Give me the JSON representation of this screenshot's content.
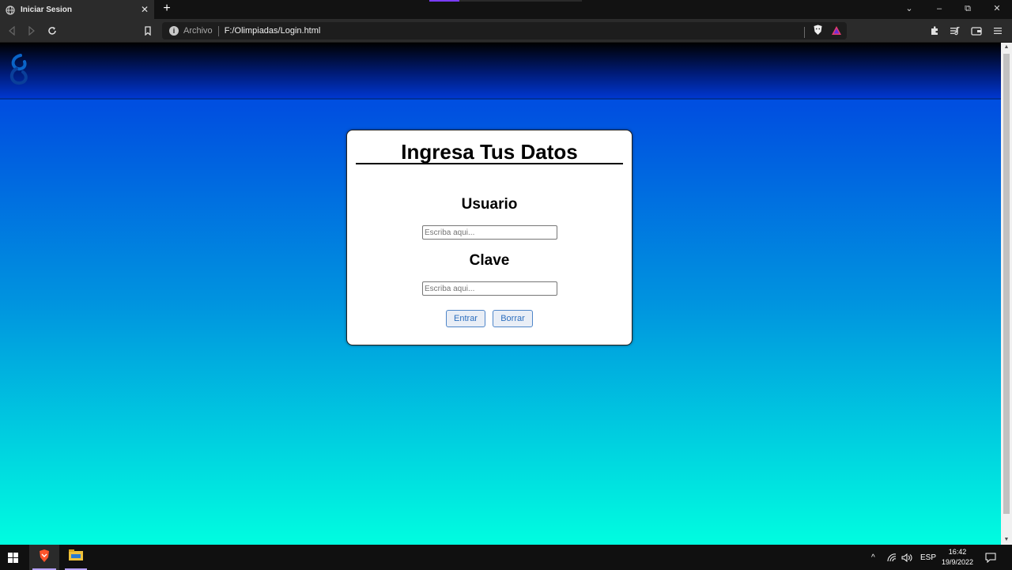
{
  "browser": {
    "tab_title": "Iniciar Sesion",
    "tab_close": "✕",
    "new_tab": "+",
    "url_scheme_label": "Archivo",
    "url": "F:/Olimpiadas/Login.html",
    "window_controls": {
      "dropdown": "⌄",
      "minimize": "–",
      "restore": "⧉",
      "close": "✕"
    }
  },
  "page": {
    "logo_icon": "swirl-logo-icon",
    "card_title": "Ingresa Tus Datos",
    "username_label": "Usuario",
    "username_placeholder": "Escriba aqui...",
    "password_label": "Clave",
    "password_placeholder": "Escriba aqui...",
    "submit_button": "Entrar",
    "reset_button": "Borrar",
    "gradient_colors": [
      "#004fe0",
      "#0094df",
      "#00fde0"
    ]
  },
  "taskbar": {
    "language": "ESP",
    "time": "16:42",
    "date": "19/9/2022",
    "tray_chevron": "^"
  }
}
